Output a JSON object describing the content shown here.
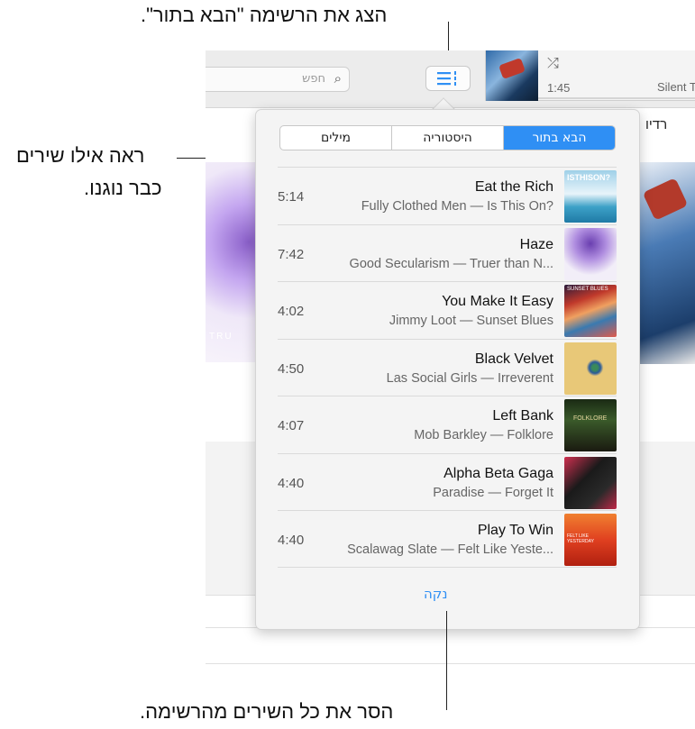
{
  "callouts": {
    "top": "הצג את הרשימה \"הבא בתור\".",
    "middle_line1": "ראה אילו שירים",
    "middle_line2": "כבר נוגנו.",
    "bottom": "הסר את כל השירים מהרשימה."
  },
  "toolbar": {
    "search_placeholder": "חפש",
    "search_icon": "magnifier-icon",
    "upnext_icon": "list-icon"
  },
  "now_playing": {
    "shuffle_icon": "shuffle-icon",
    "elapsed": "1:45",
    "title": "Silent T"
  },
  "background": {
    "tab_radio": "רדיו",
    "left_art_text": "TRU"
  },
  "popover": {
    "tabs": [
      {
        "label": "הבא בתור",
        "active": true
      },
      {
        "label": "היסטוריה",
        "active": false
      },
      {
        "label": "מילים",
        "active": false
      }
    ],
    "songs": [
      {
        "title": "Eat the Rich",
        "subtitle": "Fully Clothed Men — Is This On?",
        "duration": "5:14",
        "art_text": "ISTHISON?"
      },
      {
        "title": "Haze",
        "subtitle": "Good Secularism — Truer than N...",
        "duration": "7:42",
        "art_text": ""
      },
      {
        "title": "You Make It Easy",
        "subtitle": "Jimmy Loot — Sunset Blues",
        "duration": "4:02",
        "art_text": "SUNSET BLUES"
      },
      {
        "title": "Black Velvet",
        "subtitle": "Las Social Girls — Irreverent",
        "duration": "4:50",
        "art_text": ""
      },
      {
        "title": "Left Bank",
        "subtitle": "Mob Barkley — Folklore",
        "duration": "4:07",
        "art_text": "FOLKLORE"
      },
      {
        "title": "Alpha Beta Gaga",
        "subtitle": "Paradise — Forget It",
        "duration": "4:40",
        "art_text": ""
      },
      {
        "title": "Play To Win",
        "subtitle": "Scalawag Slate — Felt Like Yeste...",
        "duration": "4:40",
        "art_text": "FELT LIKE YESTERDAY"
      }
    ],
    "clear_label": "נקה"
  },
  "colors": {
    "accent": "#2f8ff4"
  }
}
